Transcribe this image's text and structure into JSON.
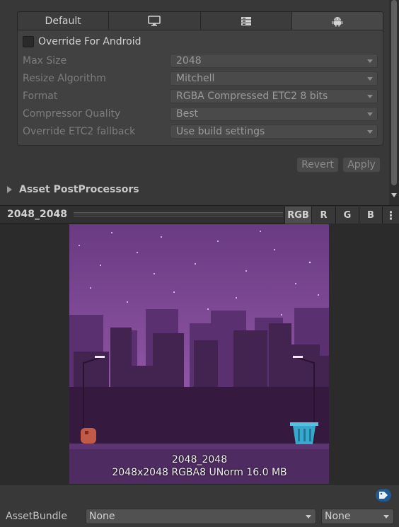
{
  "platform_tabs": [
    {
      "label": "Default",
      "icon": null
    },
    {
      "label": "",
      "icon": "monitor-icon"
    },
    {
      "label": "",
      "icon": "server-icon"
    },
    {
      "label": "",
      "icon": "android-icon"
    }
  ],
  "override": {
    "label": "Override For Android",
    "checked": false
  },
  "fields": [
    {
      "label": "Max Size",
      "value": "2048"
    },
    {
      "label": "Resize Algorithm",
      "value": "Mitchell"
    },
    {
      "label": "Format",
      "value": "RGBA Compressed ETC2 8 bits"
    },
    {
      "label": "Compressor Quality",
      "value": "Best"
    },
    {
      "label": "Override ETC2 fallback",
      "value": "Use build settings"
    }
  ],
  "buttons": {
    "revert": "Revert",
    "apply": "Apply"
  },
  "postprocessors": {
    "label": "Asset PostProcessors"
  },
  "preview": {
    "title": "2048_2048",
    "channels": [
      "RGB",
      "R",
      "G",
      "B"
    ],
    "active_channel": "RGB",
    "info_name": "2048_2048",
    "info_details": "2048x2048  RGBA8 UNorm   16.0 MB"
  },
  "asset_bundle": {
    "label": "AssetBundle",
    "name": "None",
    "variant": "None"
  },
  "colors": {
    "background": "#383838",
    "accent": "#1f5a96",
    "sky": "#7a4690"
  }
}
